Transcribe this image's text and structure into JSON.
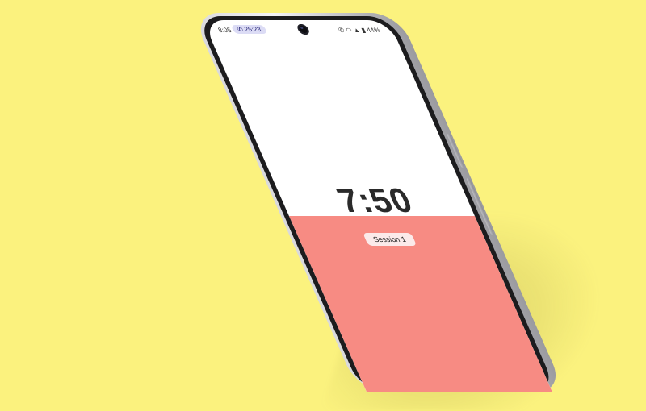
{
  "status_bar": {
    "time": "8:05",
    "call_timer": "25:23",
    "battery": "44%",
    "icons": [
      "phone-call-icon",
      "wifi-icon",
      "signal-icon",
      "battery-icon"
    ]
  },
  "timer": {
    "display": "7:50"
  },
  "session": {
    "label": "Session 1"
  },
  "colors": {
    "background": "#fbf27e",
    "screen_top": "#ffffff",
    "screen_bottom": "#f78b83",
    "timer_text": "#2a2a2a"
  }
}
